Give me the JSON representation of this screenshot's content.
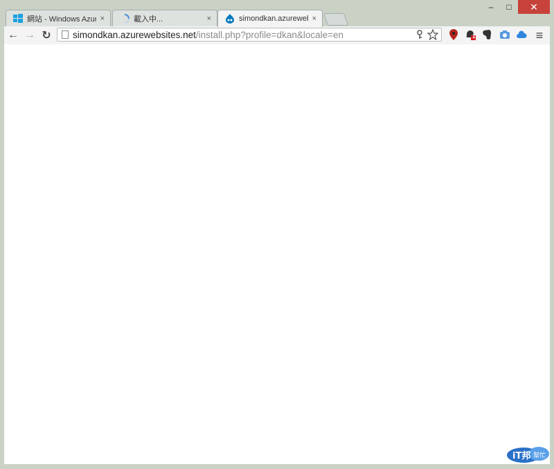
{
  "window": {
    "buttons": {
      "minimize": "–",
      "maximize": "□",
      "close": "✕"
    }
  },
  "tabs": [
    {
      "label": "網站 - Windows Azure",
      "icon": "windows-logo-icon"
    },
    {
      "label": "載入中...",
      "icon": "loading-spinner-icon"
    },
    {
      "label": "simondkan.azurewebsite",
      "icon": "drupal-icon",
      "active": true
    }
  ],
  "tab_close": "×",
  "toolbar": {
    "back": "←",
    "forward": "→",
    "reload": "↻",
    "url_host": "simondkan.azurewebsites.net",
    "url_path": "/install.php?profile=dkan&locale=en",
    "menu": "≡"
  },
  "extensions": [
    {
      "name": "map-pin-icon",
      "color": "#b3261e"
    },
    {
      "name": "notification-icon",
      "badge": "1",
      "color": "#333333"
    },
    {
      "name": "evernote-icon",
      "color": "#333333"
    },
    {
      "name": "camera-icon",
      "color": "#3a7bd5"
    },
    {
      "name": "cloud-icon",
      "color": "#2e86de"
    }
  ],
  "watermark": {
    "text1": "iT邦",
    "text2": "幫忙"
  }
}
